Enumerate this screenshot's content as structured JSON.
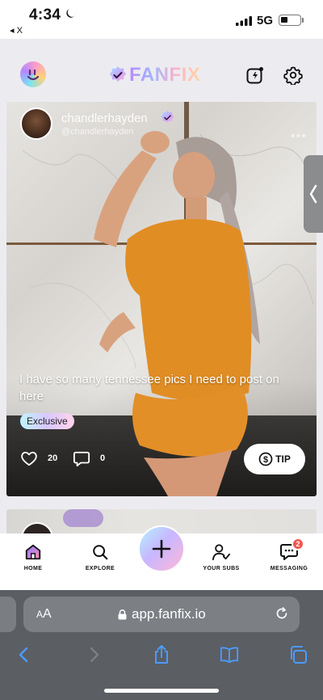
{
  "status_bar": {
    "time": "4:34",
    "back_app": "◂ X",
    "network": "5G"
  },
  "header": {
    "logo_text": "FANFIX"
  },
  "post": {
    "author_name": "chandlerhayden",
    "author_handle": "@chandlerhayden",
    "caption": "I have so many tennessee pics I need to post on here",
    "exclusive_label": "Exclusive",
    "likes": "20",
    "comments": "0",
    "tip_label": "TIP"
  },
  "nav": {
    "items": [
      {
        "label": "HOME",
        "icon": "home-icon"
      },
      {
        "label": "EXPLORE",
        "icon": "search-icon"
      },
      {
        "label": "YOUR SUBS",
        "icon": "subscriptions-icon"
      },
      {
        "label": "MESSAGING",
        "icon": "messaging-icon",
        "badge": "2"
      }
    ]
  },
  "browser": {
    "aa_small": "A",
    "aa_large": "A",
    "url": "app.fanfix.io"
  },
  "colors": {
    "accent_gradient_start": "#b5f0ff",
    "accent_gradient_mid": "#c7b7ff",
    "accent_gradient_end": "#ffb7d8",
    "badge_red": "#f4554e"
  }
}
